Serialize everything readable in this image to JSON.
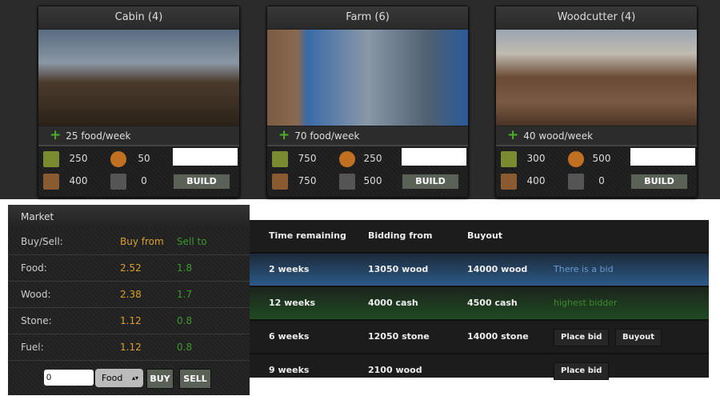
{
  "buildings": [
    {
      "title": "Cabin (4)",
      "production": "25 food/week",
      "costs": {
        "cash": "250",
        "food": "50",
        "wood": "400",
        "stone": "0"
      },
      "build_label": "BUILD",
      "quantity": ""
    },
    {
      "title": "Farm (6)",
      "production": "70 food/week",
      "costs": {
        "cash": "750",
        "food": "250",
        "wood": "750",
        "stone": "500"
      },
      "build_label": "BUILD",
      "quantity": ""
    },
    {
      "title": "Woodcutter (4)",
      "production": "40 wood/week",
      "costs": {
        "cash": "300",
        "food": "500",
        "wood": "400",
        "stone": "0"
      },
      "build_label": "BUILD",
      "quantity": ""
    }
  ],
  "market": {
    "title": "Market",
    "header": {
      "label": "Buy/Sell:",
      "buy": "Buy from",
      "sell": "Sell to"
    },
    "rows": [
      {
        "label": "Food:",
        "buy": "2.52",
        "sell": "1.8"
      },
      {
        "label": "Wood:",
        "buy": "2.38",
        "sell": "1.7"
      },
      {
        "label": "Stone:",
        "buy": "1.12",
        "sell": "0.8"
      },
      {
        "label": "Fuel:",
        "buy": "1.12",
        "sell": "0.8"
      }
    ],
    "quantity": "0",
    "resource": "Food",
    "buy_label": "BUY",
    "sell_label": "SELL"
  },
  "auctions": {
    "headers": [
      "Time remaining",
      "Bidding from",
      "Buyout"
    ],
    "rows": [
      {
        "time": "2 weeks",
        "bid": "13050 wood",
        "buyout": "14000 wood",
        "status": "There is a bid"
      },
      {
        "time": "12 weeks",
        "bid": "4000 cash",
        "buyout": "4500 cash",
        "status": "highest bidder"
      },
      {
        "time": "6 weeks",
        "bid": "12050 stone",
        "buyout": "14000 stone",
        "place_bid": "Place bid",
        "buyout_btn": "Buyout"
      },
      {
        "time": "9 weeks",
        "bid": "2100 wood",
        "buyout": "",
        "place_bid": "Place bid"
      }
    ]
  },
  "colors": {
    "buy": "#d9a030",
    "sell": "#3d9a2a",
    "bid_row": "#2c5a86",
    "bidder_row": "#1f4a22"
  }
}
